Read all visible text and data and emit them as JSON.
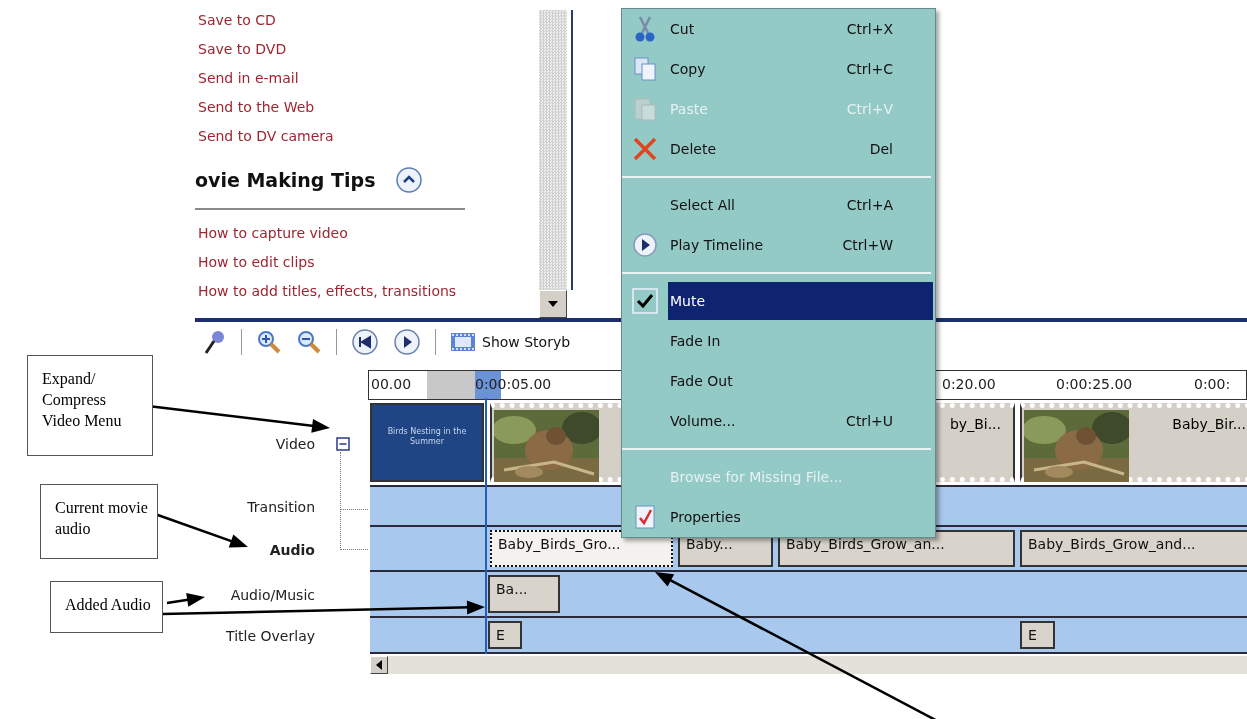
{
  "task_pane": {
    "links": [
      "Save to CD",
      "Save to DVD",
      "Send in e-mail",
      "Send to the Web",
      "Send to DV camera"
    ],
    "section": {
      "title": "ovie Making Tips",
      "expanded": true,
      "links": [
        "How to capture video",
        "How to edit clips",
        "How to add titles, effects, transitions"
      ]
    }
  },
  "toolbar": {
    "storyboard_button": "Show Storyb"
  },
  "timeline": {
    "ruler": [
      "00.00",
      "0:00:05.00",
      "0:20.00",
      "0:00:25.00",
      "0:00:"
    ],
    "tracks": [
      {
        "label": "Video",
        "bold": false,
        "expanded": true,
        "clips": [
          {
            "kind": "title",
            "text": "Birds Nesting in the Summer"
          },
          {
            "kind": "video",
            "thumbnail": true
          },
          {
            "kind": "video",
            "name": "by_Bi..."
          },
          {
            "kind": "video",
            "thumbnail": true,
            "name": "Baby_Bir..."
          }
        ]
      },
      {
        "label": "Transition",
        "bold": false
      },
      {
        "label": "Audio",
        "bold": true,
        "clips": [
          {
            "kind": "audio",
            "name": "Baby_Birds_Gro...",
            "selected": true
          },
          {
            "kind": "audio",
            "name": "Baby...",
            "selected": false
          },
          {
            "kind": "audio",
            "name": "Baby_Birds_Grow_an...",
            "selected": false
          },
          {
            "kind": "audio",
            "name": "Baby_Birds_Grow_and...",
            "selected": false
          }
        ]
      },
      {
        "label": "Audio/Music",
        "bold": false,
        "clips": [
          {
            "kind": "audio",
            "name": "Ba...",
            "selected": false
          }
        ]
      },
      {
        "label": "Title Overlay",
        "bold": false,
        "clips": [
          {
            "kind": "audio",
            "name": "E",
            "selected": false
          },
          {
            "kind": "audio",
            "name": "E",
            "selected": false
          }
        ]
      }
    ]
  },
  "context_menu": {
    "items": [
      {
        "kind": "item",
        "label": "Cut",
        "shortcut": "Ctrl+X",
        "disabled": false,
        "checked": false,
        "selected": false
      },
      {
        "kind": "item",
        "label": "Copy",
        "shortcut": "Ctrl+C",
        "disabled": false,
        "checked": false,
        "selected": false
      },
      {
        "kind": "item",
        "label": "Paste",
        "shortcut": "Ctrl+V",
        "disabled": true,
        "checked": false,
        "selected": false
      },
      {
        "kind": "item",
        "label": "Delete",
        "shortcut": "Del",
        "disabled": false,
        "checked": false,
        "selected": false
      },
      {
        "kind": "separator"
      },
      {
        "kind": "item",
        "label": "Select All",
        "shortcut": "Ctrl+A",
        "disabled": false,
        "checked": false,
        "selected": false
      },
      {
        "kind": "item",
        "label": "Play Timeline",
        "shortcut": "Ctrl+W",
        "disabled": false,
        "checked": false,
        "selected": false
      },
      {
        "kind": "separator"
      },
      {
        "kind": "item",
        "label": "Mute",
        "disabled": false,
        "checked": true,
        "selected": true
      },
      {
        "kind": "item",
        "label": "Fade In",
        "disabled": false,
        "checked": false,
        "selected": false
      },
      {
        "kind": "item",
        "label": "Fade Out",
        "disabled": false,
        "checked": false,
        "selected": false
      },
      {
        "kind": "item",
        "label": "Volume...",
        "shortcut": "Ctrl+U",
        "disabled": false,
        "checked": false,
        "selected": false
      },
      {
        "kind": "separator"
      },
      {
        "kind": "item",
        "label": "Browse for Missing File...",
        "disabled": true,
        "checked": false,
        "selected": false
      },
      {
        "kind": "item",
        "label": "Properties",
        "disabled": false,
        "checked": false,
        "selected": false
      }
    ]
  },
  "annotations": [
    {
      "lines": [
        "Expand/",
        "Compress",
        "Video Menu"
      ]
    },
    {
      "lines": [
        "Current movie",
        "audio"
      ]
    },
    {
      "lines": [
        "Added Audio"
      ]
    }
  ]
}
